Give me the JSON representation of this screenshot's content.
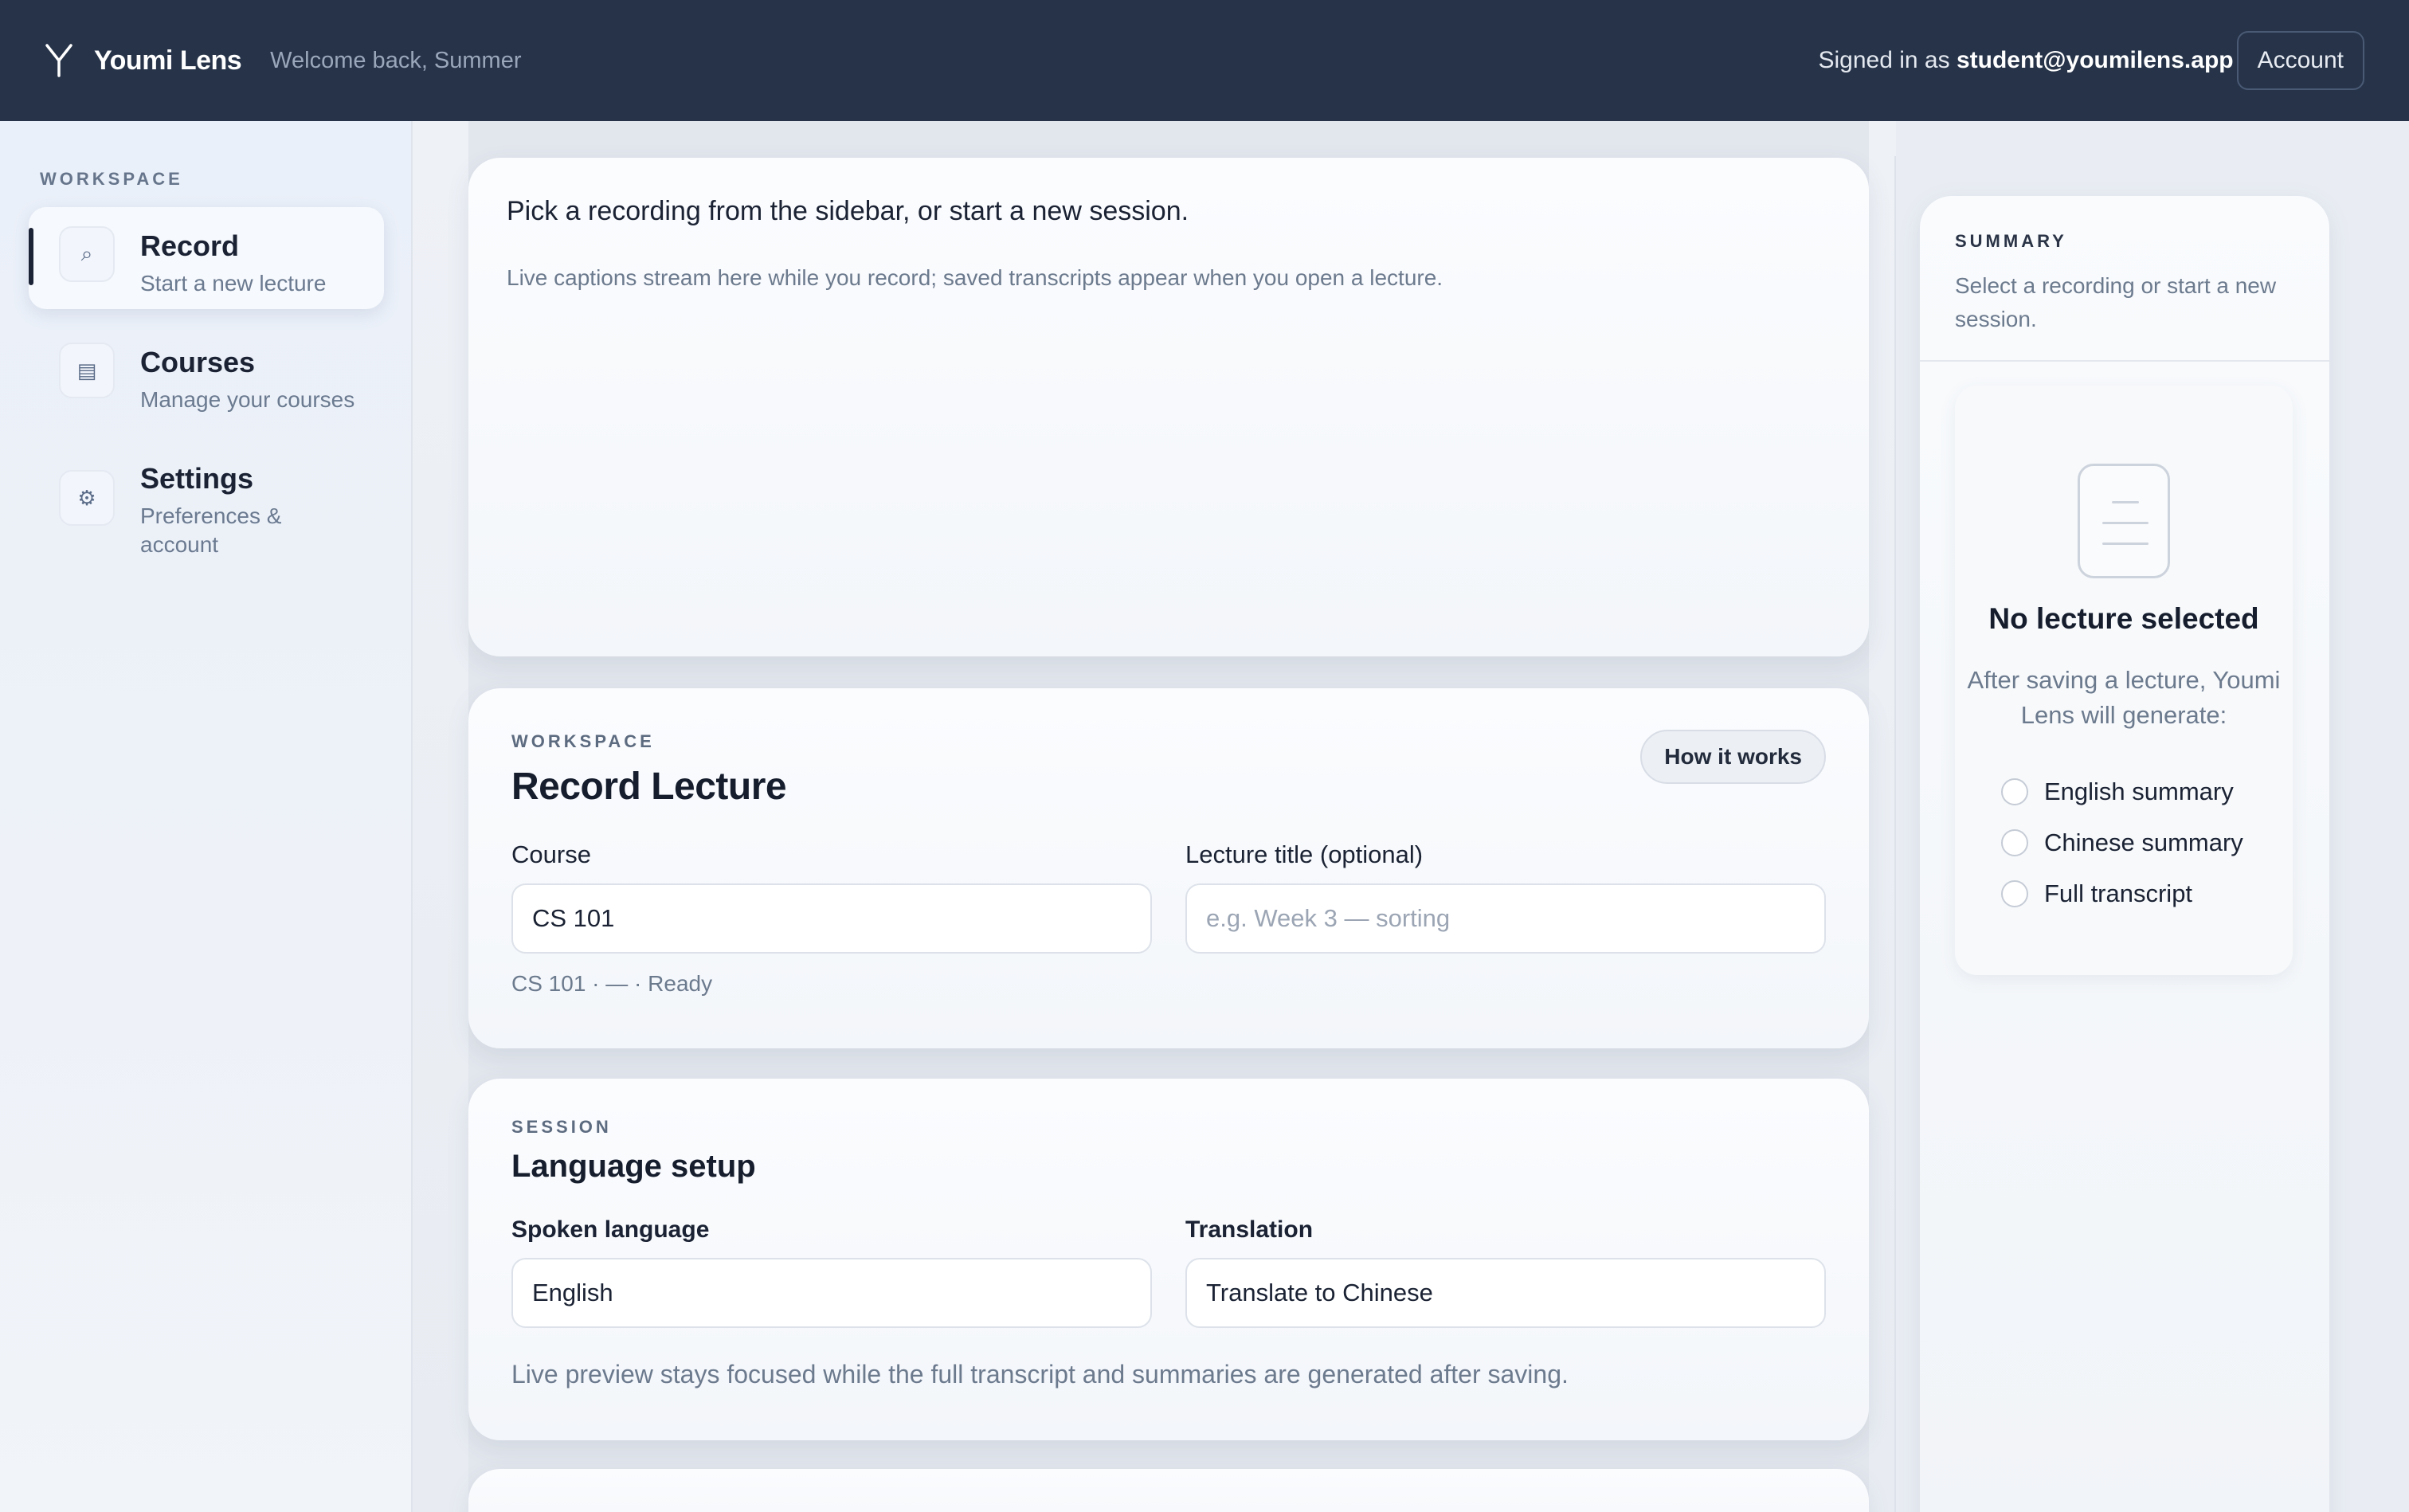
{
  "header": {
    "app_name": "Youmi Lens",
    "welcome": "Welcome back, Summer",
    "signed_in_prefix": "Signed in as",
    "user_email": "student@youmilens.app",
    "account_label": "Account"
  },
  "sidebar": {
    "section_label": "WORKSPACE",
    "items": [
      {
        "icon": "search-icon",
        "glyph": "⌕",
        "title": "Record",
        "subtitle": "Start a new lecture",
        "active": true
      },
      {
        "icon": "courses-icon",
        "glyph": "▤",
        "title": "Courses",
        "subtitle": "Manage your courses",
        "active": false
      },
      {
        "icon": "gear-icon",
        "glyph": "⚙",
        "title": "Settings",
        "subtitle": "Preferences & account",
        "active": false
      }
    ]
  },
  "captions": {
    "primary": "Pick a recording from the sidebar, or start a new session.",
    "secondary": "Live captions stream here while you record; saved transcripts appear when you open a lecture."
  },
  "record": {
    "eyebrow": "WORKSPACE",
    "title": "Record Lecture",
    "how_it_works": "How it works",
    "course_label": "Course",
    "course_value": "CS 101",
    "lecture_title_label": "Lecture title (optional)",
    "lecture_title_placeholder": "e.g. Week 3 — sorting",
    "status_line": "CS 101 · — · Ready"
  },
  "language": {
    "eyebrow": "SESSION",
    "title": "Language setup",
    "spoken_label": "Spoken language",
    "spoken_value": "English",
    "translation_label": "Translation",
    "translation_value": "Translate to Chinese",
    "note": "Live preview stays focused while the full transcript and summaries are generated after saving."
  },
  "summary": {
    "eyebrow": "SUMMARY",
    "description": "Select a recording or start a new session.",
    "empty_title": "No lecture selected",
    "empty_desc": "After saving a lecture, Youmi Lens will generate:",
    "outputs": [
      "English summary",
      "Chinese summary",
      "Full transcript"
    ]
  },
  "colors": {
    "topbar": "#263349",
    "accent_dark": "#1b2436",
    "muted_text": "#6c7a8e"
  }
}
